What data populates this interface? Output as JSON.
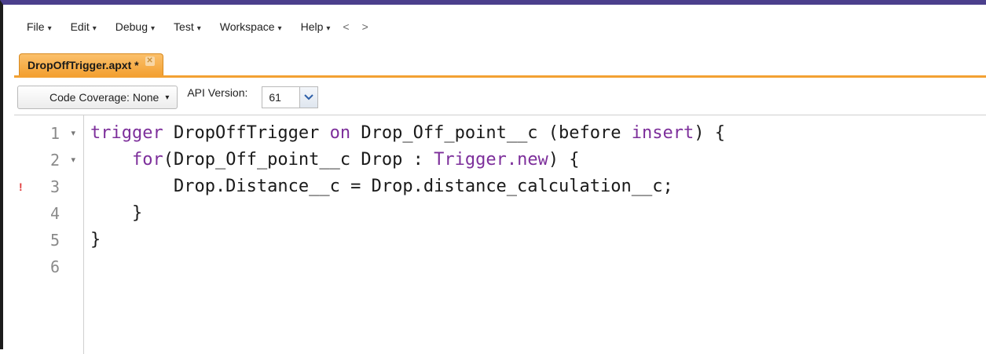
{
  "menu": {
    "items": [
      {
        "label": "File",
        "caret": "▾"
      },
      {
        "label": "Edit",
        "caret": "▾"
      },
      {
        "label": "Debug",
        "caret": "▾"
      },
      {
        "label": "Test",
        "caret": "▾"
      },
      {
        "label": "Workspace",
        "caret": "▾"
      },
      {
        "label": "Help",
        "caret": "▾"
      }
    ],
    "back": "<",
    "forward": ">"
  },
  "tab": {
    "title": "DropOffTrigger.apxt *",
    "close_glyph": "✕"
  },
  "toolbar": {
    "coverage_label": "Code Coverage: None",
    "coverage_caret": "▾",
    "api_label": "API Version:",
    "api_value": "61"
  },
  "editor": {
    "lines": [
      {
        "num": "1",
        "fold": "▾"
      },
      {
        "num": "2",
        "fold": "▾"
      },
      {
        "num": "3",
        "fold": "",
        "warning": "!"
      },
      {
        "num": "4",
        "fold": ""
      },
      {
        "num": "5",
        "fold": ""
      },
      {
        "num": "6",
        "fold": ""
      }
    ],
    "code": {
      "l1": {
        "kw1": "trigger",
        "t1": " DropOffTrigger ",
        "kw2": "on",
        "t2": " Drop_Off_point__c (before ",
        "kw3": "insert",
        "t3": ") {"
      },
      "l2": {
        "indent": "    ",
        "kw1": "for",
        "t1": "(Drop_Off_point__c Drop : ",
        "kw2": "Trigger.new",
        "t2": ") {"
      },
      "l3": {
        "text": "        Drop.Distance__c = Drop.distance_calculation__c;"
      },
      "l4": {
        "text": "    }"
      },
      "l5": {
        "text": "}"
      },
      "l6": {
        "text": ""
      }
    }
  },
  "colors": {
    "tab_accent": "#f3a133",
    "keyword": "#7d2f9b",
    "window_top": "#4b3f8c"
  }
}
